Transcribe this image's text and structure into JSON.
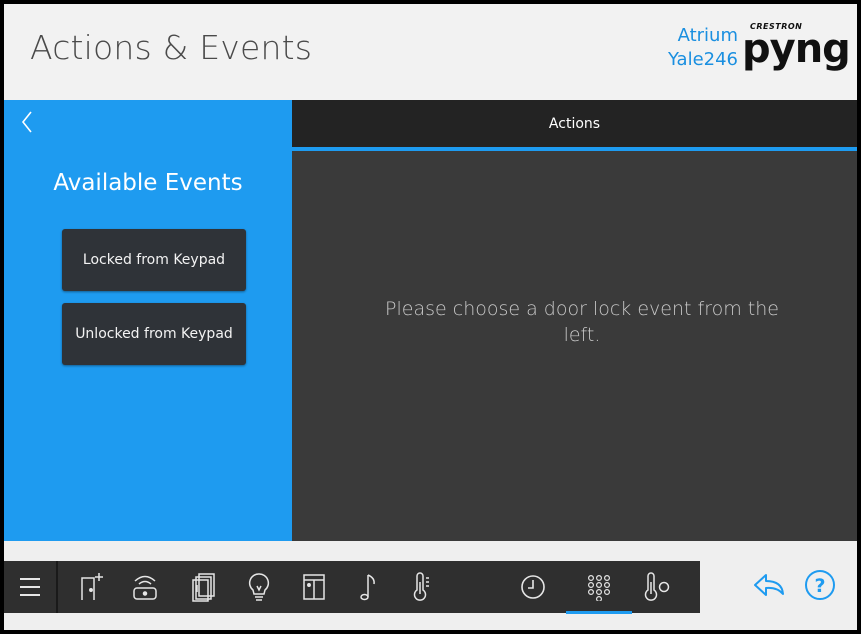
{
  "header": {
    "title": "Actions & Events",
    "location_line1": "Atrium",
    "location_line2": "Yale246",
    "logo_small": "CRESTRON",
    "logo_main": "pyng"
  },
  "left_panel": {
    "back_icon": "chevron-left-icon",
    "title": "Available Events",
    "events": [
      {
        "label": "Locked from Keypad"
      },
      {
        "label": "Unlocked from Keypad"
      }
    ]
  },
  "main_panel": {
    "tab_label": "Actions",
    "message": "Please choose a door lock event from the left."
  },
  "toolbar": {
    "items": [
      "menu-icon",
      "door-add-icon",
      "remote-icon",
      "shades-icon",
      "lightbulb-icon",
      "window-icon",
      "music-note-icon",
      "thermometer-icon",
      "clock-icon",
      "keypad-icon",
      "temperature-sensor-icon"
    ],
    "active_item": "keypad-icon",
    "right_items": [
      "back-arrow-icon",
      "help-icon"
    ]
  },
  "colors": {
    "accent_blue": "#1e9bf0",
    "dark_panel": "#3a3a3a",
    "header_bar": "#232323",
    "button_dark": "#2f3338"
  }
}
